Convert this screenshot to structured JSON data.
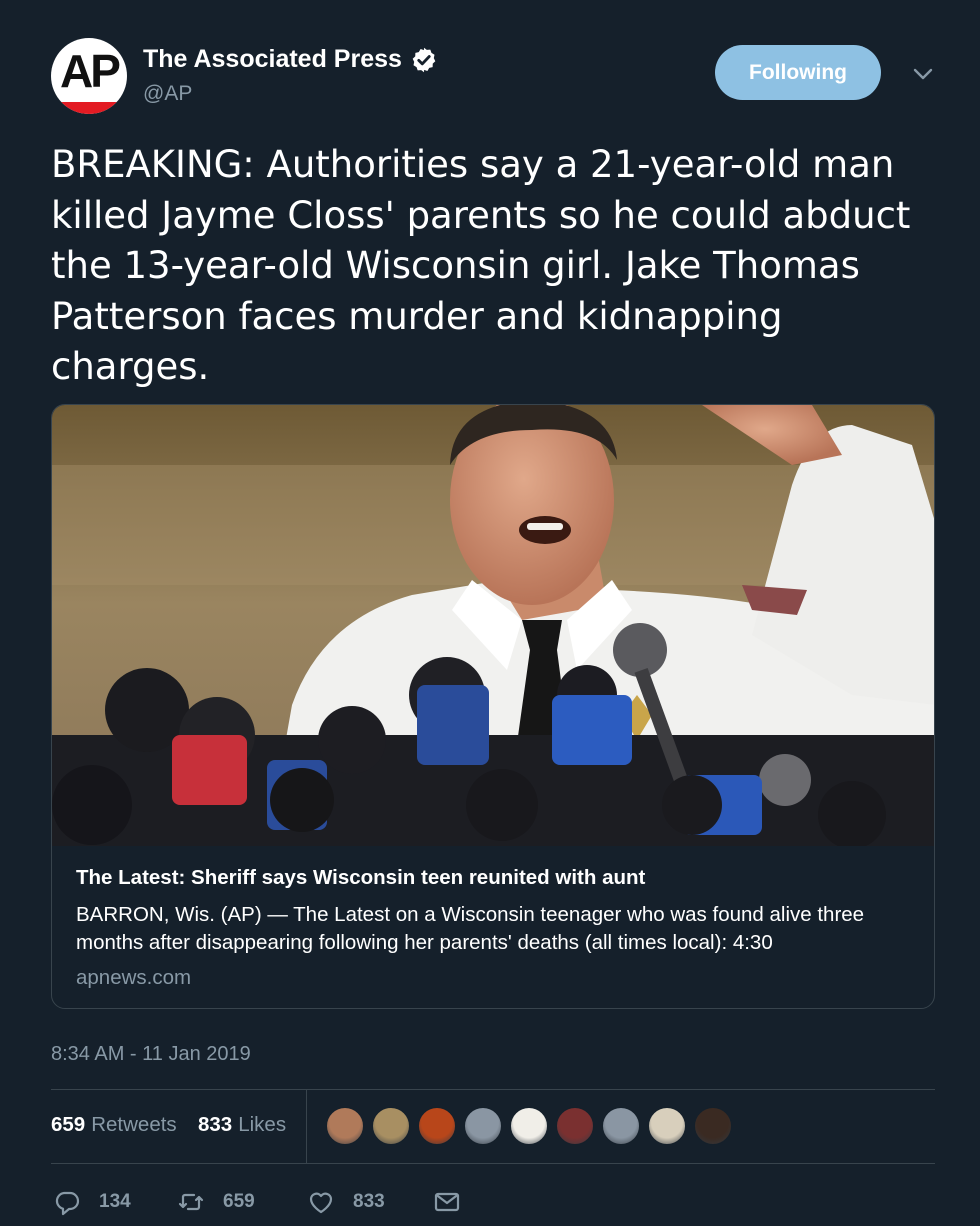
{
  "author": {
    "display_name": "The Associated Press",
    "handle": "@AP",
    "avatar_text": "AP",
    "verified": true
  },
  "follow_button": {
    "label": "Following"
  },
  "tweet": {
    "text": "BREAKING: Authorities say a 21-year-old man killed Jayme Closs' parents so he could abduct the 13-year-old Wisconsin girl. Jake Thomas Patterson faces murder and kidnapping charges."
  },
  "card": {
    "title": "The Latest: Sheriff says Wisconsin teen reunited with aunt",
    "description": "BARRON, Wis. (AP) — The Latest on a Wisconsin teenager who was found alive three months after disappearing following her parents' deaths (all times local): 4:30",
    "domain": "apnews.com"
  },
  "timestamp": "8:34 AM - 11 Jan 2019",
  "stats": {
    "retweets_count": "659",
    "retweets_label": "Retweets",
    "likes_count": "833",
    "likes_label": "Likes"
  },
  "actions": {
    "reply_count": "134",
    "retweet_count": "659",
    "like_count": "833"
  },
  "colors": {
    "background": "#15202b",
    "secondary_text": "#8899a6",
    "border": "#38444d",
    "follow_button": "#8ec1e3",
    "ap_red": "#e31b23"
  },
  "liker_avatar_colors": [
    "#b07a5a",
    "#a88f62",
    "#b8461a",
    "#8a96a3",
    "#f0eee8",
    "#7a3030",
    "#8a96a3",
    "#d8cfbc",
    "#3a2a22"
  ]
}
